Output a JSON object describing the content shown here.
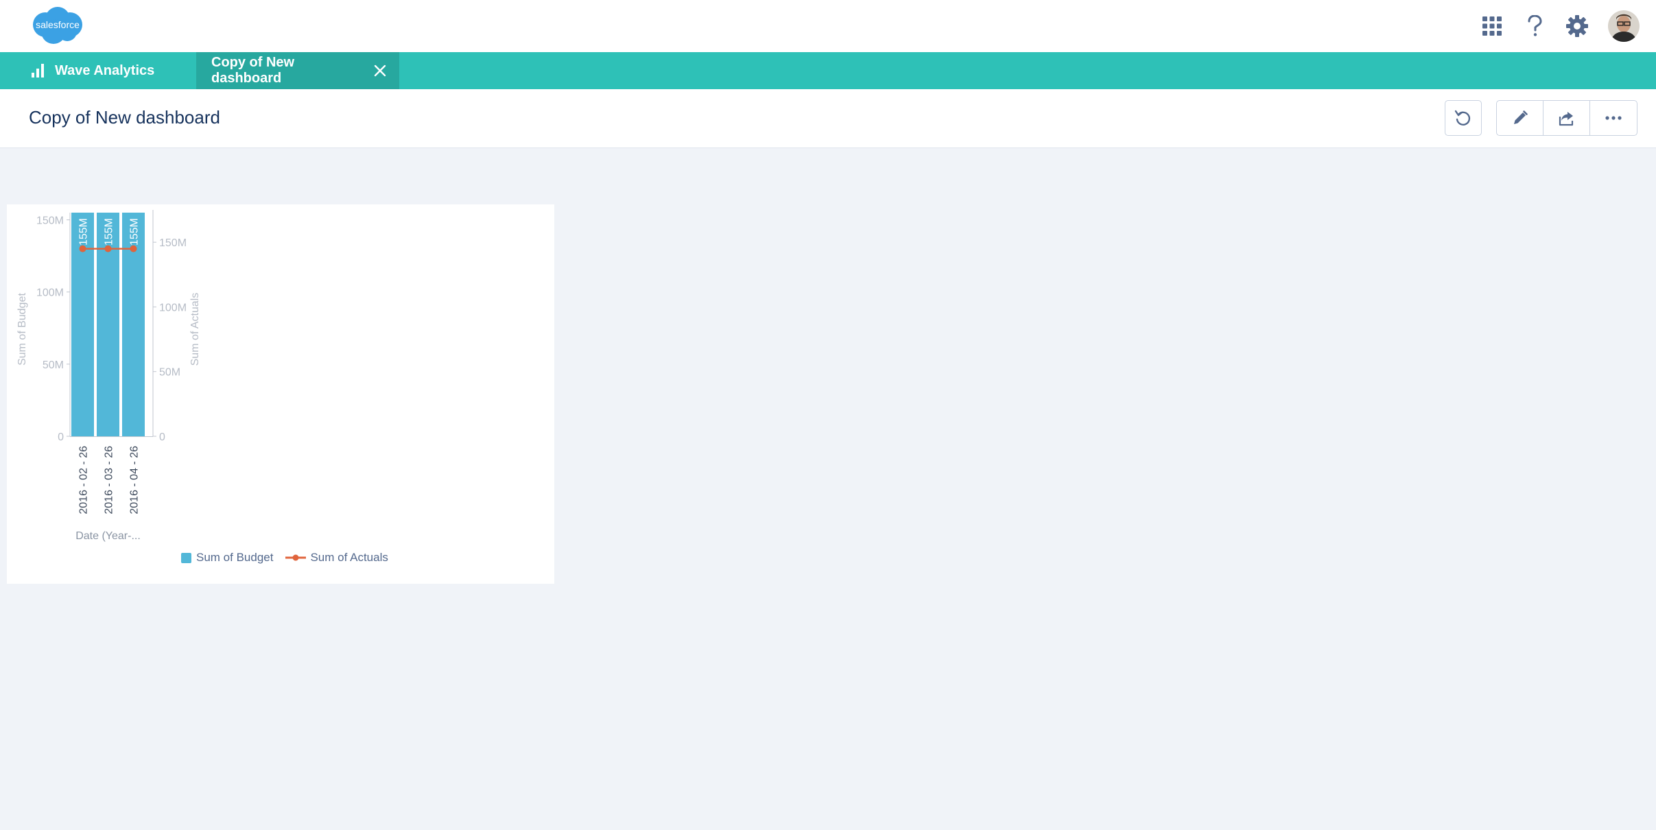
{
  "header": {
    "logo_text": "salesforce",
    "icons": [
      "app-launcher-icon",
      "help-icon",
      "setup-gear-icon",
      "user-avatar"
    ]
  },
  "tabs": {
    "app_tab_label": "Wave Analytics",
    "active_tab_label": "Copy of New dashboard"
  },
  "page": {
    "title": "Copy of New dashboard"
  },
  "colors": {
    "brand_teal": "#2ec1b7",
    "active_tab_teal": "#27a89f",
    "bar_blue": "#52b7d8",
    "line_orange": "#e0643c"
  },
  "chart_data": {
    "type": "bar",
    "categories": [
      "2016 - 02 - 26",
      "2016 - 03 - 26",
      "2016 - 04 - 26"
    ],
    "xlabel": "Date (Year-...",
    "series": [
      {
        "name": "Sum of Budget",
        "kind": "bar",
        "axis": "left",
        "values": [
          155000000,
          155000000,
          155000000
        ],
        "data_labels": [
          "155M",
          "155M",
          "155M"
        ]
      },
      {
        "name": "Sum of Actuals",
        "kind": "line",
        "axis": "right",
        "values": [
          145000000,
          145000000,
          145000000
        ]
      }
    ],
    "y_left": {
      "label": "Sum of Budget",
      "ylim": [
        0,
        155000000
      ],
      "ticks": [
        0,
        50000000,
        100000000,
        150000000
      ],
      "tick_labels": [
        "0",
        "50M",
        "100M",
        "150M"
      ]
    },
    "y_right": {
      "label": "Sum of Actuals",
      "ylim": [
        0,
        175000000
      ],
      "ticks": [
        0,
        50000000,
        100000000,
        150000000
      ],
      "tick_labels": [
        "0",
        "50M",
        "100M",
        "150M"
      ]
    },
    "grid": false,
    "legend_position": "bottom-center"
  }
}
